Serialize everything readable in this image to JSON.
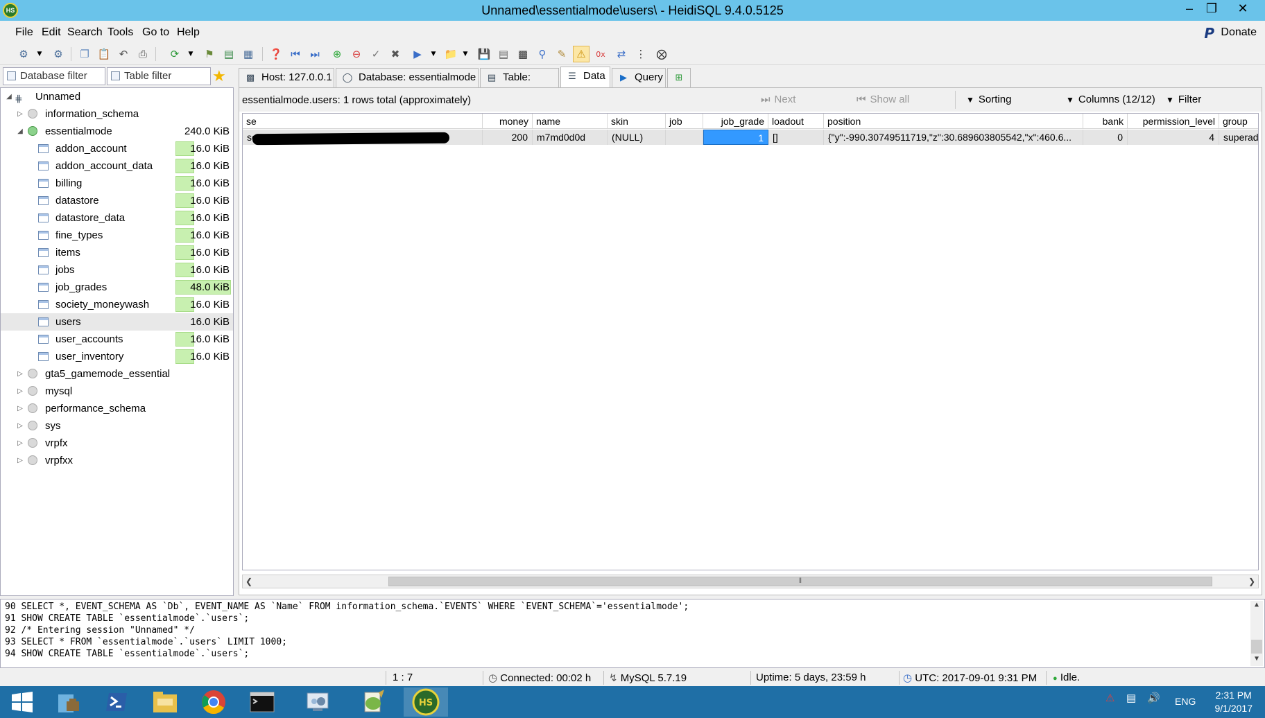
{
  "window": {
    "title": "Unnamed\\essentialmode\\users\\ - HeidiSQL 9.4.0.5125",
    "app_icon": "HS"
  },
  "menu": [
    "File",
    "Edit",
    "Search",
    "Tools",
    "Go to",
    "Help"
  ],
  "donate_label": "Donate",
  "filters": {
    "database_placeholder": "Database filter",
    "table_placeholder": "Table filter"
  },
  "tree": {
    "root": "Unnamed",
    "databases": [
      {
        "name": "information_schema"
      },
      {
        "name": "essentialmode",
        "size": "240.0 KiB",
        "tables": [
          {
            "name": "addon_account",
            "size": "16.0 KiB"
          },
          {
            "name": "addon_account_data",
            "size": "16.0 KiB"
          },
          {
            "name": "billing",
            "size": "16.0 KiB"
          },
          {
            "name": "datastore",
            "size": "16.0 KiB"
          },
          {
            "name": "datastore_data",
            "size": "16.0 KiB"
          },
          {
            "name": "fine_types",
            "size": "16.0 KiB"
          },
          {
            "name": "items",
            "size": "16.0 KiB"
          },
          {
            "name": "jobs",
            "size": "16.0 KiB"
          },
          {
            "name": "job_grades",
            "size": "48.0 KiB"
          },
          {
            "name": "society_moneywash",
            "size": "16.0 KiB"
          },
          {
            "name": "users",
            "size": "16.0 KiB"
          },
          {
            "name": "user_accounts",
            "size": "16.0 KiB"
          },
          {
            "name": "user_inventory",
            "size": "16.0 KiB"
          }
        ]
      },
      {
        "name": "gta5_gamemode_essential"
      },
      {
        "name": "mysql"
      },
      {
        "name": "performance_schema"
      },
      {
        "name": "sys"
      },
      {
        "name": "vrpfx"
      },
      {
        "name": "vrpfxx"
      }
    ]
  },
  "tabs": [
    "Host: 127.0.0.1",
    "Database: essentialmode",
    "Table: users",
    "Data",
    "Query"
  ],
  "data": {
    "rows_info": "essentialmode.users: 1 rows total (approximately)",
    "next_label": "Next",
    "show_all_label": "Show all",
    "sorting_label": "Sorting",
    "columns_label": "Columns (12/12)",
    "filter_label": "Filter",
    "columns": [
      "se",
      "money",
      "name",
      "skin",
      "job",
      "job_grade",
      "loadout",
      "position",
      "bank",
      "permission_level",
      "group"
    ],
    "row": [
      "se",
      "200",
      "m7md0d0d",
      "(NULL)",
      "",
      "1",
      "[]",
      "{\"y\":-990.30749511719,\"z\":30.689603805542,\"x\":460.6...",
      "0",
      "4",
      "superad"
    ]
  },
  "sql_log": [
    {
      "n": "90",
      "text": "SELECT *, EVENT_SCHEMA AS `Db`, EVENT_NAME AS `Name` FROM information_schema.`EVENTS` WHERE `EVENT_SCHEMA`='essentialmode';"
    },
    {
      "n": "91",
      "text": "SHOW CREATE TABLE `essentialmode`.`users`;"
    },
    {
      "n": "92",
      "text": "/* Entering session \"Unnamed\" */"
    },
    {
      "n": "93",
      "text": "SELECT * FROM `essentialmode`.`users` LIMIT 1000;"
    },
    {
      "n": "94",
      "text": "SHOW CREATE TABLE `essentialmode`.`users`;"
    }
  ],
  "status": {
    "cursor": "1 : 7",
    "connected": "Connected: 00:02 h",
    "server": "MySQL 5.7.19",
    "uptime": "Uptime: 5 days, 23:59 h",
    "utc": "UTC: 2017-09-01 9:31 PM",
    "state": "Idle."
  },
  "taskbar": {
    "lang": "ENG",
    "time": "2:31 PM",
    "date": "9/1/2017"
  }
}
